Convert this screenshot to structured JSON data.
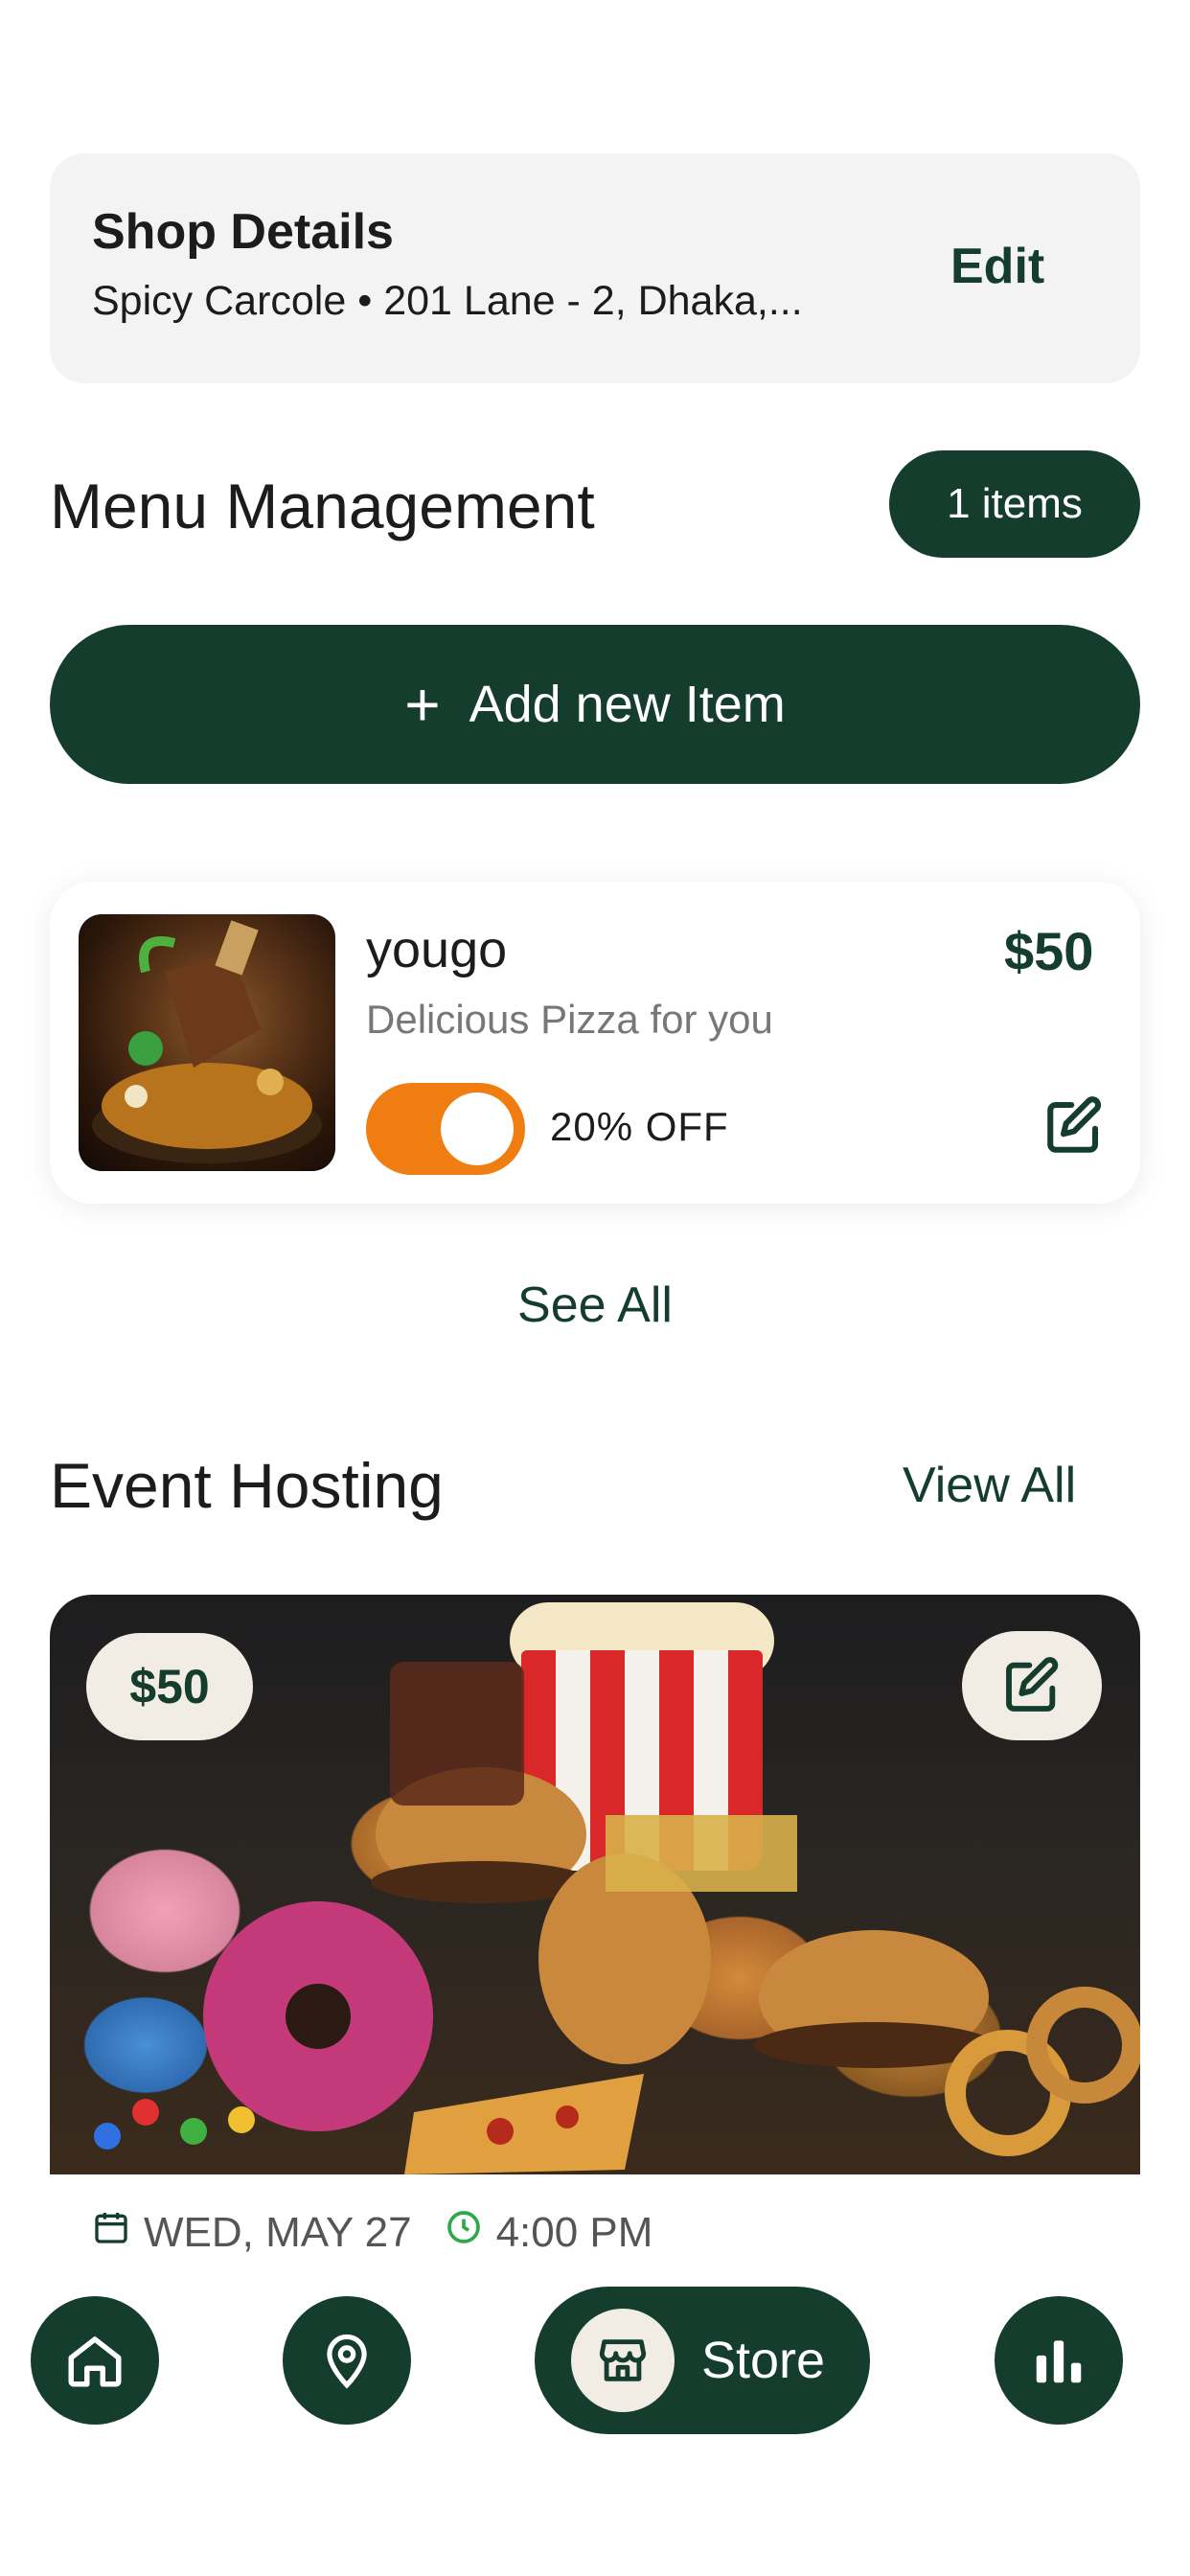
{
  "shop": {
    "title": "Shop Details",
    "subtitle": "Spicy Carcole • 201 Lane - 2, Dhaka,...",
    "edit_label": "Edit"
  },
  "menu": {
    "title": "Menu Management",
    "count_badge": "1 items",
    "add_label": "Add new Item",
    "items": [
      {
        "name": "yougo",
        "price": "$50",
        "description": "Delicious Pizza for you",
        "discount": "20% OFF",
        "enabled": true
      }
    ],
    "see_all": "See All"
  },
  "events": {
    "title": "Event Hosting",
    "view_all": "View All",
    "card": {
      "price": "$50",
      "date": "WED, MAY 27",
      "time": "4:00 PM"
    }
  },
  "nav": {
    "store_label": "Store",
    "items": [
      "home-icon",
      "location-icon",
      "store-icon",
      "chart-icon"
    ]
  },
  "colors": {
    "brand": "#143d2e",
    "accent": "#f07d12",
    "card_bg": "#f3f3f3"
  }
}
